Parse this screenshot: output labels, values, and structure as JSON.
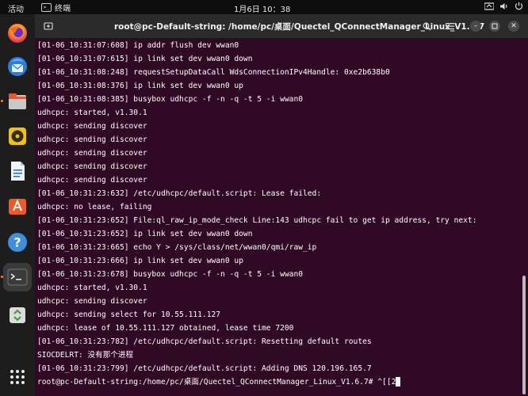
{
  "topbar": {
    "activities": "活动",
    "app_name": "终端",
    "clock": "1月6日  10：38",
    "tray_icons": [
      "network-icon",
      "volume-icon",
      "power-icon"
    ]
  },
  "dock": {
    "items": [
      {
        "name": "firefox-icon"
      },
      {
        "name": "thunderbird-icon"
      },
      {
        "name": "files-icon"
      },
      {
        "name": "rhythmbox-icon"
      },
      {
        "name": "writer-icon"
      },
      {
        "name": "software-icon"
      },
      {
        "name": "help-icon"
      },
      {
        "name": "terminal-icon"
      },
      {
        "name": "trash-icon"
      },
      {
        "name": "app-grid-icon"
      }
    ]
  },
  "window": {
    "title": "root@pc-Default-string: /home/pc/桌面/Quectel_QConnectManager_Linux_V1.6.7"
  },
  "terminal": {
    "lines": [
      "[01-06_10:31:07:608] ip addr flush dev wwan0",
      "[01-06_10:31:07:615] ip link set dev wwan0 down",
      "[01-06_10:31:08:248] requestSetupDataCall WdsConnectionIPv4Handle: 0xe2b638b0",
      "[01-06_10:31:08:376] ip link set dev wwan0 up",
      "[01-06_10:31:08:385] busybox udhcpc -f -n -q -t 5 -i wwan0",
      "udhcpc: started, v1.30.1",
      "udhcpc: sending discover",
      "udhcpc: sending discover",
      "udhcpc: sending discover",
      "udhcpc: sending discover",
      "udhcpc: sending discover",
      "[01-06_10:31:23:632] /etc/udhcpc/default.script: Lease failed:",
      "udhcpc: no lease, failing",
      "[01-06_10:31:23:652] File:ql_raw_ip_mode_check Line:143 udhcpc fail to get ip address, try next:",
      "[01-06_10:31:23:652] ip link set dev wwan0 down",
      "[01-06_10:31:23:665] echo Y > /sys/class/net/wwan0/qmi/raw_ip",
      "[01-06_10:31:23:666] ip link set dev wwan0 up",
      "[01-06_10:31:23:678] busybox udhcpc -f -n -q -t 5 -i wwan0",
      "udhcpc: started, v1.30.1",
      "udhcpc: sending discover",
      "udhcpc: sending select for 10.55.111.127",
      "udhcpc: lease of 10.55.111.127 obtained, lease time 7200",
      "[01-06_10:31:23:782] /etc/udhcpc/default.script: Resetting default routes",
      "SIOCDELRT: 没有那个进程",
      "[01-06_10:31:23:799] /etc/udhcpc/default.script: Adding DNS 120.196.165.7"
    ],
    "prompt": "root@pc-Default-string:/home/pc/桌面/Quectel_QConnectManager_Linux_V1.6.7# ^[[2"
  }
}
